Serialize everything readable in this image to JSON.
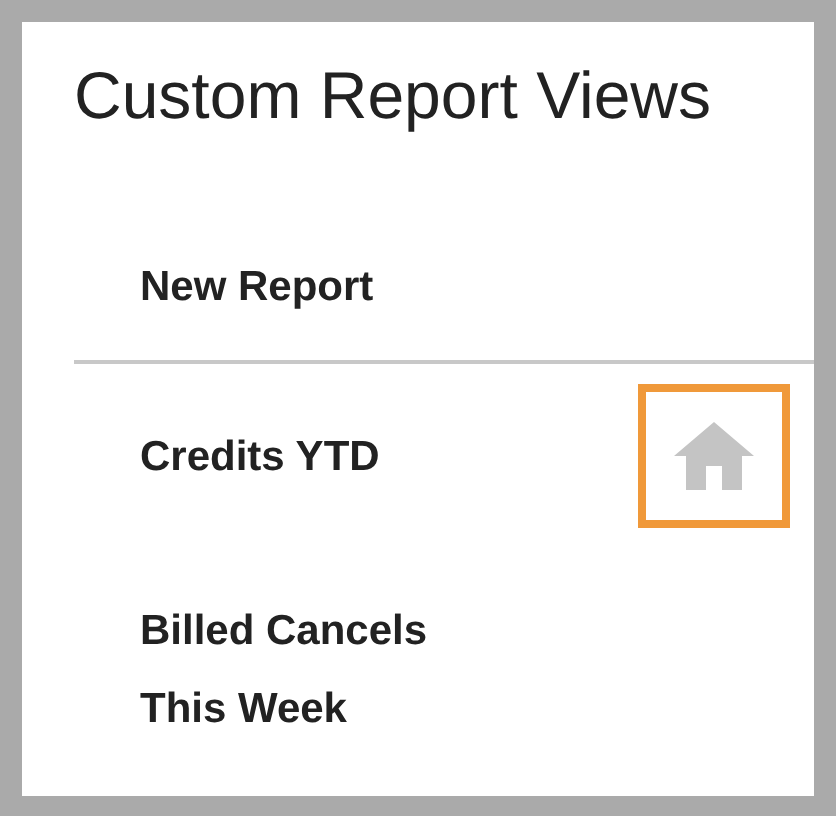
{
  "title": "Custom Report Views",
  "items": [
    {
      "label": "New Report",
      "kind": "action",
      "home": false
    },
    {
      "label": "Credits YTD",
      "kind": "view",
      "home": true
    },
    {
      "label": "Billed Cancels This Week",
      "kind": "view",
      "home": false
    }
  ]
}
